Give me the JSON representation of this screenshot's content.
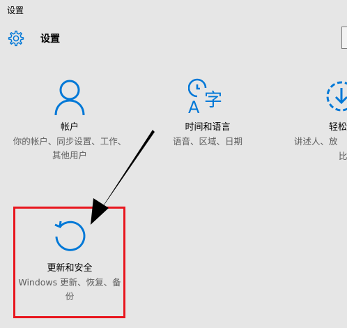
{
  "window": {
    "title": "设置"
  },
  "header": {
    "title": "设置",
    "icon": "gear-icon"
  },
  "accent_color": "#0078d7",
  "highlight_color": "#e8161e",
  "tiles": [
    {
      "icon": "person-icon",
      "title": "帐户",
      "description": "你的帐户、同步设置、工作、其他用户"
    },
    {
      "icon": "time-language-icon",
      "title": "时间和语言",
      "description": "语音、区域、日期"
    },
    {
      "icon": "ease-of-access-icon",
      "title": "轻松",
      "description": "讲述人、放",
      "description2": "比"
    },
    {
      "icon": "update-refresh-icon",
      "title": "更新和安全",
      "description": "Windows 更新、恢复、备份"
    }
  ]
}
